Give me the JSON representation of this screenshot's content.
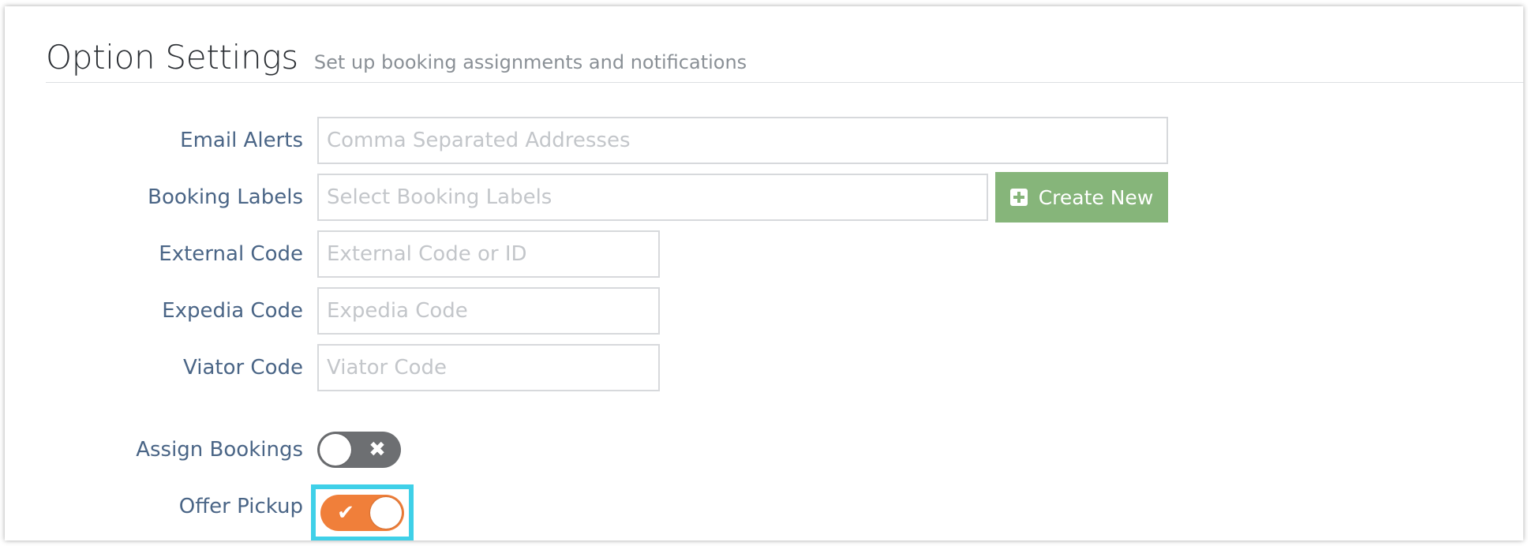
{
  "header": {
    "title": "Option Settings",
    "subtitle": "Set up booking assignments and notifications"
  },
  "fields": {
    "email_alerts": {
      "label": "Email Alerts",
      "placeholder": "Comma Separated Addresses",
      "value": ""
    },
    "booking_labels": {
      "label": "Booking Labels",
      "placeholder": "Select Booking Labels",
      "value": "",
      "create_button_label": "Create New",
      "create_button_icon": "plus-square-icon"
    },
    "external_code": {
      "label": "External Code",
      "placeholder": "External Code or ID",
      "value": ""
    },
    "expedia_code": {
      "label": "Expedia Code",
      "placeholder": "Expedia Code",
      "value": ""
    },
    "viator_code": {
      "label": "Viator Code",
      "placeholder": "Viator Code",
      "value": ""
    }
  },
  "toggles": {
    "assign_bookings": {
      "label": "Assign Bookings",
      "state": "off",
      "glyph": "✖",
      "icon": "x-icon"
    },
    "offer_pickup": {
      "label": "Offer Pickup",
      "state": "on",
      "glyph": "✔",
      "icon": "check-icon",
      "highlighted": true
    }
  },
  "colors": {
    "label_text": "#4a6586",
    "create_button": "#86b57a",
    "toggle_on": "#f07f3a",
    "toggle_off": "#6d6f72",
    "highlight": "#3fd0e8"
  }
}
